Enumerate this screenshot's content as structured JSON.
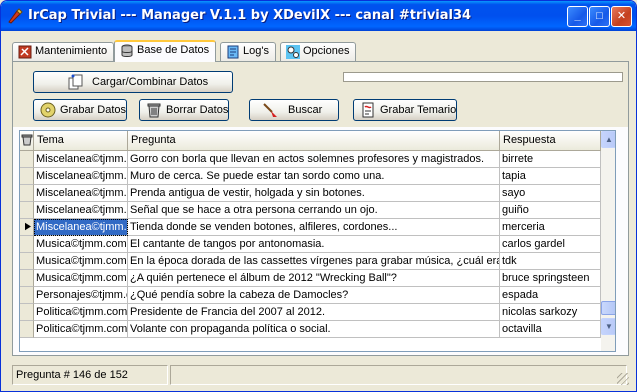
{
  "window": {
    "title": "IrCap Trivial --- Manager V.1.1 by XDevilX --- canal #trivial34",
    "minimize_label": "_",
    "maximize_label": "□",
    "close_label": "✕"
  },
  "tabs": [
    {
      "label": "Mantenimiento",
      "icon": "gear-hammer-icon",
      "active": false
    },
    {
      "label": "Base de Datos",
      "icon": "database-icon",
      "active": true
    },
    {
      "label": "Log's",
      "icon": "log-document-icon",
      "active": false
    },
    {
      "label": "Opciones",
      "icon": "options-gears-icon",
      "active": false
    }
  ],
  "toolbar": {
    "load_label": "Cargar/Combinar Datos",
    "save_label": "Grabar Datos",
    "delete_label": "Borrar Datos",
    "search_label": "Buscar",
    "save_topic_label": "Grabar Temario",
    "progress_fraction": 0
  },
  "grid": {
    "columns": [
      "Tema",
      "Pregunta",
      "Respuesta"
    ],
    "selected_row": 4,
    "rows": [
      {
        "tema": "Miscelanea©tjmm.c",
        "pregunta": "Gorro con borla que llevan en actos solemnes profesores y magistrados.",
        "respuesta": "birrete"
      },
      {
        "tema": "Miscelanea©tjmm.c",
        "pregunta": "Muro de cerca. Se puede estar tan sordo como una.",
        "respuesta": "tapia"
      },
      {
        "tema": "Miscelanea©tjmm.c",
        "pregunta": "Prenda antigua de vestir, holgada y sin botones.",
        "respuesta": "sayo"
      },
      {
        "tema": "Miscelanea©tjmm.c",
        "pregunta": "Señal que se hace a otra persona cerrando un ojo.",
        "respuesta": "guiño"
      },
      {
        "tema": "Miscelanea©tjmm.c",
        "pregunta": "Tienda donde se venden botones, alfileres, cordones...",
        "respuesta": "merceria"
      },
      {
        "tema": "Musica©tjmm.com",
        "pregunta": "El cantante de tangos por antonomasia.",
        "respuesta": "carlos gardel"
      },
      {
        "tema": "Musica©tjmm.com",
        "pregunta": "En la época dorada de las cassettes vírgenes para grabar música, ¿cuál era la",
        "respuesta": "tdk"
      },
      {
        "tema": "Musica©tjmm.com",
        "pregunta": "¿A quién pertenece el álbum de 2012 \"Wrecking Ball\"?",
        "respuesta": "bruce springsteen"
      },
      {
        "tema": "Personajes©tjmm.c",
        "pregunta": "¿Qué pendía sobre la cabeza de Damocles?",
        "respuesta": "espada"
      },
      {
        "tema": "Politica©tjmm.com",
        "pregunta": "Presidente de Francia del 2007 al 2012.",
        "respuesta": "nicolas sarkozy"
      },
      {
        "tema": "Politica©tjmm.com",
        "pregunta": "Volante con propaganda política o social.",
        "respuesta": "octavilla"
      }
    ]
  },
  "status": {
    "question_counter": "Pregunta # 146 de 152"
  }
}
